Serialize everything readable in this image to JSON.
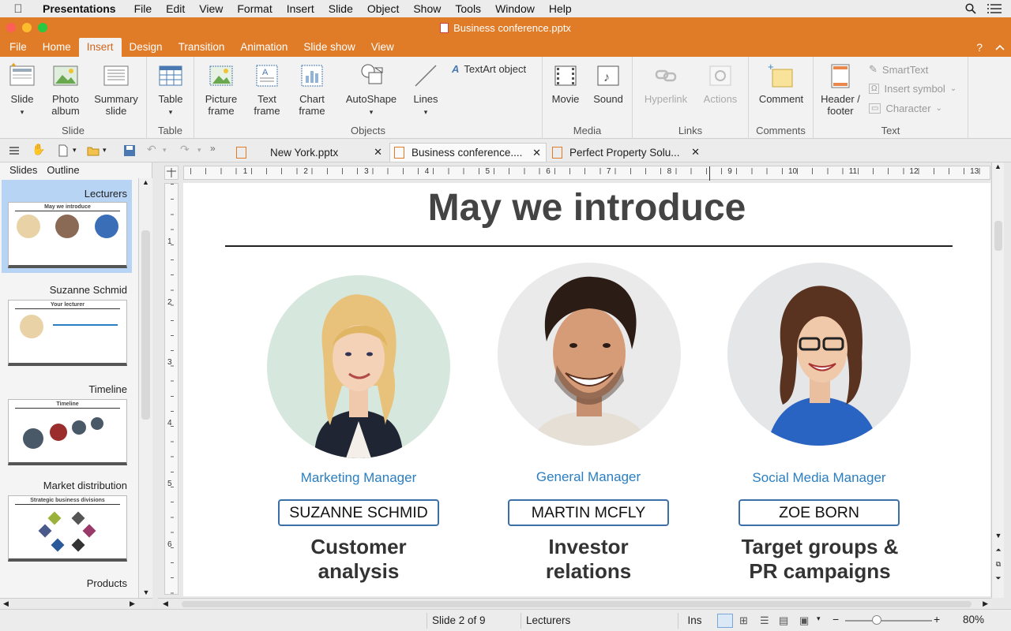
{
  "menubar": {
    "app": "Presentations",
    "items": [
      "File",
      "Edit",
      "View",
      "Format",
      "Insert",
      "Slide",
      "Object",
      "Show",
      "Tools",
      "Window",
      "Help"
    ]
  },
  "window": {
    "title": "Business conference.pptx"
  },
  "ribbon_tabs": [
    "File",
    "Home",
    "Insert",
    "Design",
    "Transition",
    "Animation",
    "Slide show",
    "View"
  ],
  "ribbon": {
    "slide_group": {
      "label": "Slide",
      "slide": "Slide",
      "photo_album": "Photo album",
      "summary_slide": "Summary slide"
    },
    "table_group": {
      "label": "Table",
      "table": "Table"
    },
    "objects_group": {
      "label": "Objects",
      "picture_frame": "Picture frame",
      "text_frame": "Text frame",
      "chart_frame": "Chart frame",
      "autoshape": "AutoShape",
      "lines": "Lines",
      "textart": "TextArt object"
    },
    "media_group": {
      "label": "Media",
      "movie": "Movie",
      "sound": "Sound"
    },
    "links_group": {
      "label": "Links",
      "hyperlink": "Hyperlink",
      "actions": "Actions"
    },
    "comments_group": {
      "label": "Comments",
      "comment": "Comment"
    },
    "text_group": {
      "label": "Text",
      "header_footer": "Header / footer",
      "smarttext": "SmartText",
      "insert_symbol": "Insert symbol",
      "character": "Character"
    }
  },
  "doc_tabs": [
    {
      "label": "New York.pptx"
    },
    {
      "label": "Business conference...."
    },
    {
      "label": "Perfect Property Solu..."
    }
  ],
  "sidebar": {
    "tabs": [
      "Slides",
      "Outline"
    ],
    "slides": [
      {
        "label": "Lecturers",
        "title": "May we introduce"
      },
      {
        "label": "Suzanne Schmid",
        "title": "Your lecturer"
      },
      {
        "label": "Timeline",
        "title": "Timeline"
      },
      {
        "label": "Market distribution",
        "title": "Strategic business divisions"
      },
      {
        "label": "Products",
        "title": ""
      }
    ]
  },
  "ruler": {
    "h_marks": [
      "1",
      "2",
      "3",
      "4",
      "5",
      "6",
      "7",
      "8",
      "9",
      "10",
      "11",
      "12",
      "13"
    ],
    "v_marks": [
      "1",
      "2",
      "3",
      "4",
      "5",
      "6"
    ]
  },
  "slide": {
    "title": "May we introduce",
    "people": [
      {
        "role": "Marketing Manager",
        "name": "SUZANNE SCHMID",
        "topic_line1": "Customer",
        "topic_line2": "analysis"
      },
      {
        "role": "General Manager",
        "name": "MARTIN MCFLY",
        "topic_line1": "Investor",
        "topic_line2": "relations"
      },
      {
        "role": "Social Media Manager",
        "name": "ZOE BORN",
        "topic_line1": "Target groups &",
        "topic_line2": "PR campaigns"
      }
    ]
  },
  "statusbar": {
    "slide_pos": "Slide 2 of 9",
    "slide_name": "Lecturers",
    "mode": "Ins",
    "zoom": "80%"
  },
  "colors": {
    "accent": "#e07b28",
    "link_blue": "#2a7ec2",
    "name_border": "#3b6fa8"
  }
}
